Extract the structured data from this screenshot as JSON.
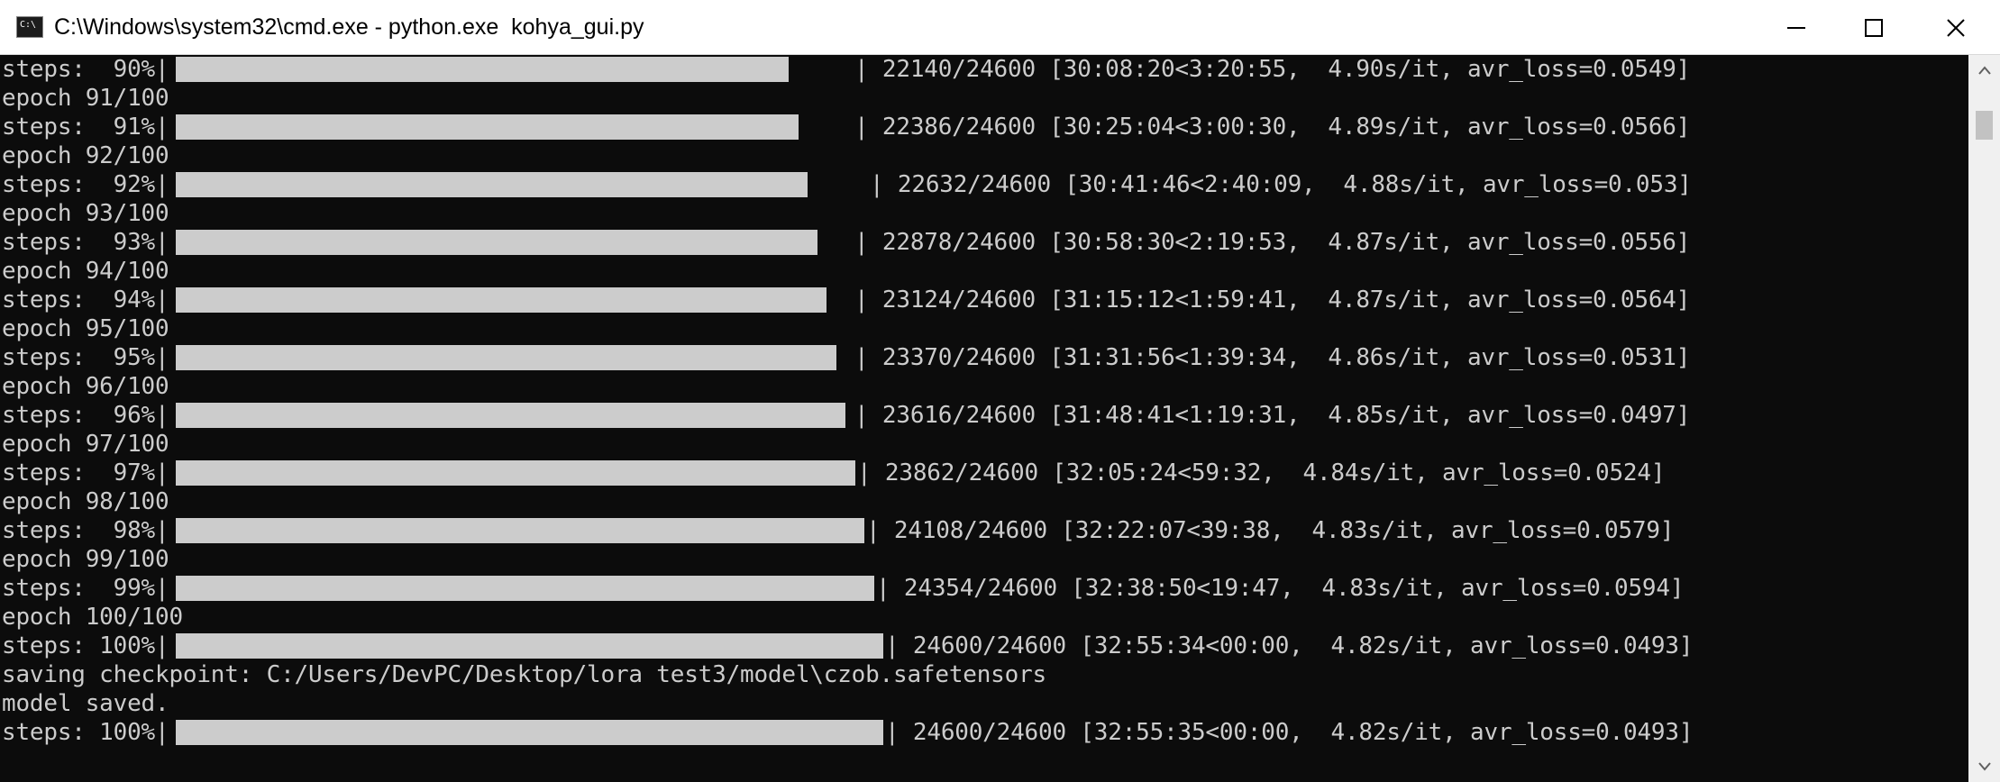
{
  "window": {
    "title": "C:\\Windows\\system32\\cmd.exe - python.exe  kohya_gui.py",
    "icon_label": "C:\\"
  },
  "terminal": {
    "lines": [
      {
        "kind": "steps",
        "prefix": "steps:  90%|",
        "progress": 0.9,
        "suffix": "| 22140/24600 [30:08:20<3:20:55,  4.90s/it, avr_loss=0.0549]"
      },
      {
        "kind": "text",
        "text": "epoch 91/100"
      },
      {
        "kind": "steps",
        "prefix": "steps:  91%|",
        "progress": 0.91,
        "suffix": "| 22386/24600 [30:25:04<3:00:30,  4.89s/it, avr_loss=0.0566]"
      },
      {
        "kind": "text",
        "text": "epoch 92/100"
      },
      {
        "kind": "steps",
        "prefix": "steps:  92%|",
        "progress": 0.92,
        "suffix": "| 22632/24600 [30:41:46<2:40:09,  4.88s/it, avr_loss=0.053]"
      },
      {
        "kind": "text",
        "text": "epoch 93/100"
      },
      {
        "kind": "steps",
        "prefix": "steps:  93%|",
        "progress": 0.93,
        "suffix": "| 22878/24600 [30:58:30<2:19:53,  4.87s/it, avr_loss=0.0556]"
      },
      {
        "kind": "text",
        "text": "epoch 94/100"
      },
      {
        "kind": "steps",
        "prefix": "steps:  94%|",
        "progress": 0.94,
        "suffix": "| 23124/24600 [31:15:12<1:59:41,  4.87s/it, avr_loss=0.0564]"
      },
      {
        "kind": "text",
        "text": "epoch 95/100"
      },
      {
        "kind": "steps",
        "prefix": "steps:  95%|",
        "progress": 0.95,
        "suffix": "| 23370/24600 [31:31:56<1:39:34,  4.86s/it, avr_loss=0.0531]"
      },
      {
        "kind": "text",
        "text": "epoch 96/100"
      },
      {
        "kind": "steps",
        "prefix": "steps:  96%|",
        "progress": 0.96,
        "suffix": "| 23616/24600 [31:48:41<1:19:31,  4.85s/it, avr_loss=0.0497]"
      },
      {
        "kind": "text",
        "text": "epoch 97/100"
      },
      {
        "kind": "steps",
        "prefix": "steps:  97%|",
        "progress": 0.97,
        "suffix": "| 23862/24600 [32:05:24<59:32,  4.84s/it, avr_loss=0.0524]"
      },
      {
        "kind": "text",
        "text": "epoch 98/100"
      },
      {
        "kind": "steps",
        "prefix": "steps:  98%|",
        "progress": 0.98,
        "suffix": "| 24108/24600 [32:22:07<39:38,  4.83s/it, avr_loss=0.0579]"
      },
      {
        "kind": "text",
        "text": "epoch 99/100"
      },
      {
        "kind": "steps",
        "prefix": "steps:  99%|",
        "progress": 0.99,
        "suffix": "| 24354/24600 [32:38:50<19:47,  4.83s/it, avr_loss=0.0594]"
      },
      {
        "kind": "text",
        "text": "epoch 100/100"
      },
      {
        "kind": "steps",
        "prefix": "steps: 100%|",
        "progress": 1.0,
        "suffix": "| 24600/24600 [32:55:34<00:00,  4.82s/it, avr_loss=0.0493]"
      },
      {
        "kind": "text",
        "text": "saving checkpoint: C:/Users/DevPC/Desktop/lora test3/model\\czob.safetensors"
      },
      {
        "kind": "text",
        "text": "model saved."
      },
      {
        "kind": "steps",
        "prefix": "steps: 100%|",
        "progress": 1.0,
        "suffix": "| 24600/24600 [32:55:35<00:00,  4.82s/it, avr_loss=0.0493]"
      }
    ]
  },
  "colors": {
    "terminal_bg": "#0c0c0c",
    "terminal_fg": "#cccccc",
    "bar_fill": "#cccccc",
    "titlebar_bg": "#ffffff"
  },
  "icons": {
    "minimize": "minimize-icon",
    "maximize": "maximize-icon",
    "close": "close-icon",
    "scroll_up": "chevron-up-icon",
    "scroll_down": "chevron-down-icon"
  }
}
